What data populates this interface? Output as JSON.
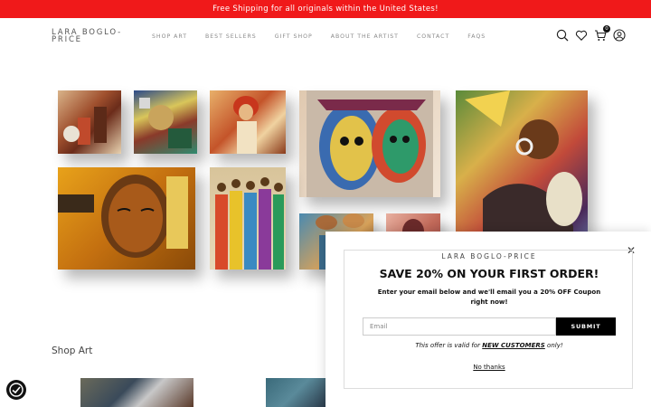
{
  "banner": {
    "text": "Free Shipping for all originals within the United States!"
  },
  "header": {
    "logo": "LARA BOGLO-PRICE",
    "nav": [
      "SHOP ART",
      "BEST SELLERS",
      "GIFT SHOP",
      "ABOUT THE ARTIST",
      "CONTACT",
      "FAQS"
    ],
    "cart_count": "0"
  },
  "main": {
    "section_title": "Shop Art"
  },
  "popup": {
    "brand": "LARA BOGLO-PRICE",
    "heading": "SAVE 20% ON YOUR FIRST ORDER!",
    "subtext": "Enter your email below and we'll email you a 20% OFF Coupon right now!",
    "email_placeholder": "Email",
    "submit_label": "SUBMIT",
    "offer_prefix": "This offer is valid for ",
    "offer_highlight": "NEW CUSTOMERS",
    "offer_suffix": " only!",
    "no_thanks": "No thanks",
    "close_symbol": "✕"
  },
  "colors": {
    "banner": "#f0191a",
    "button": "#000000"
  },
  "icons": [
    "search-icon",
    "heart-icon",
    "cart-icon",
    "account-icon",
    "accessibility-icon",
    "close-icon"
  ]
}
